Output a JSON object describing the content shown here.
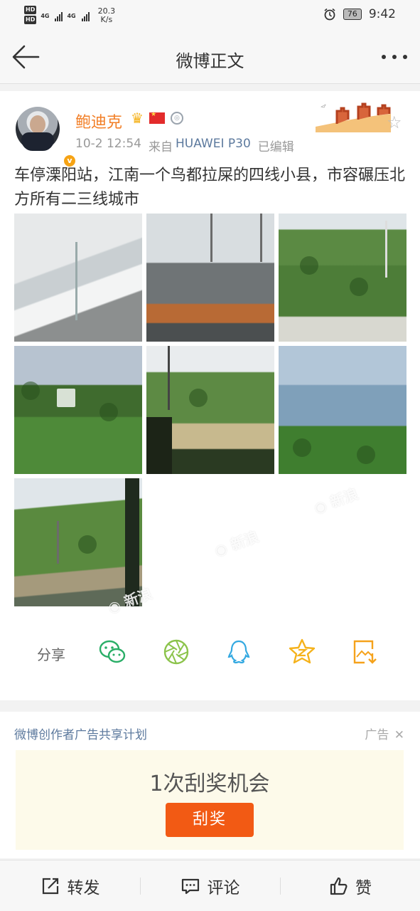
{
  "status_bar": {
    "net_speed_value": "20.3",
    "net_speed_unit": "K/s",
    "signal_label_1": "4G",
    "signal_label_2": "4G",
    "battery": "76",
    "time": "9:42"
  },
  "nav": {
    "title": "微博正文"
  },
  "post": {
    "username": "鲍迪克",
    "timestamp": "10-2 12:54",
    "source_prefix": "来自",
    "source_device": "HUAWEI P30",
    "edited": "已编辑",
    "text": "车停溧阳站，江南一个鸟都拉屎的四线小县，市容碾压北方所有二三线城市",
    "photo_count": 7
  },
  "share": {
    "label": "分享",
    "targets": [
      "wechat-icon",
      "moments-icon",
      "qq-icon",
      "qzone-icon",
      "save-image-icon"
    ]
  },
  "ad": {
    "title": "微博创作者广告共享计划",
    "tag": "广告",
    "close": "✕",
    "chance_text": "1次刮奖机会",
    "button": "刮奖"
  },
  "toolbar": {
    "repost": "转发",
    "comment": "评论",
    "like": "赞"
  },
  "colors": {
    "username": "#f27f27",
    "link": "#5d7a9e",
    "ad_button": "#f25a14",
    "wechat": "#2aae67",
    "qq": "#34a9e1",
    "qzone": "#f5b21b"
  }
}
